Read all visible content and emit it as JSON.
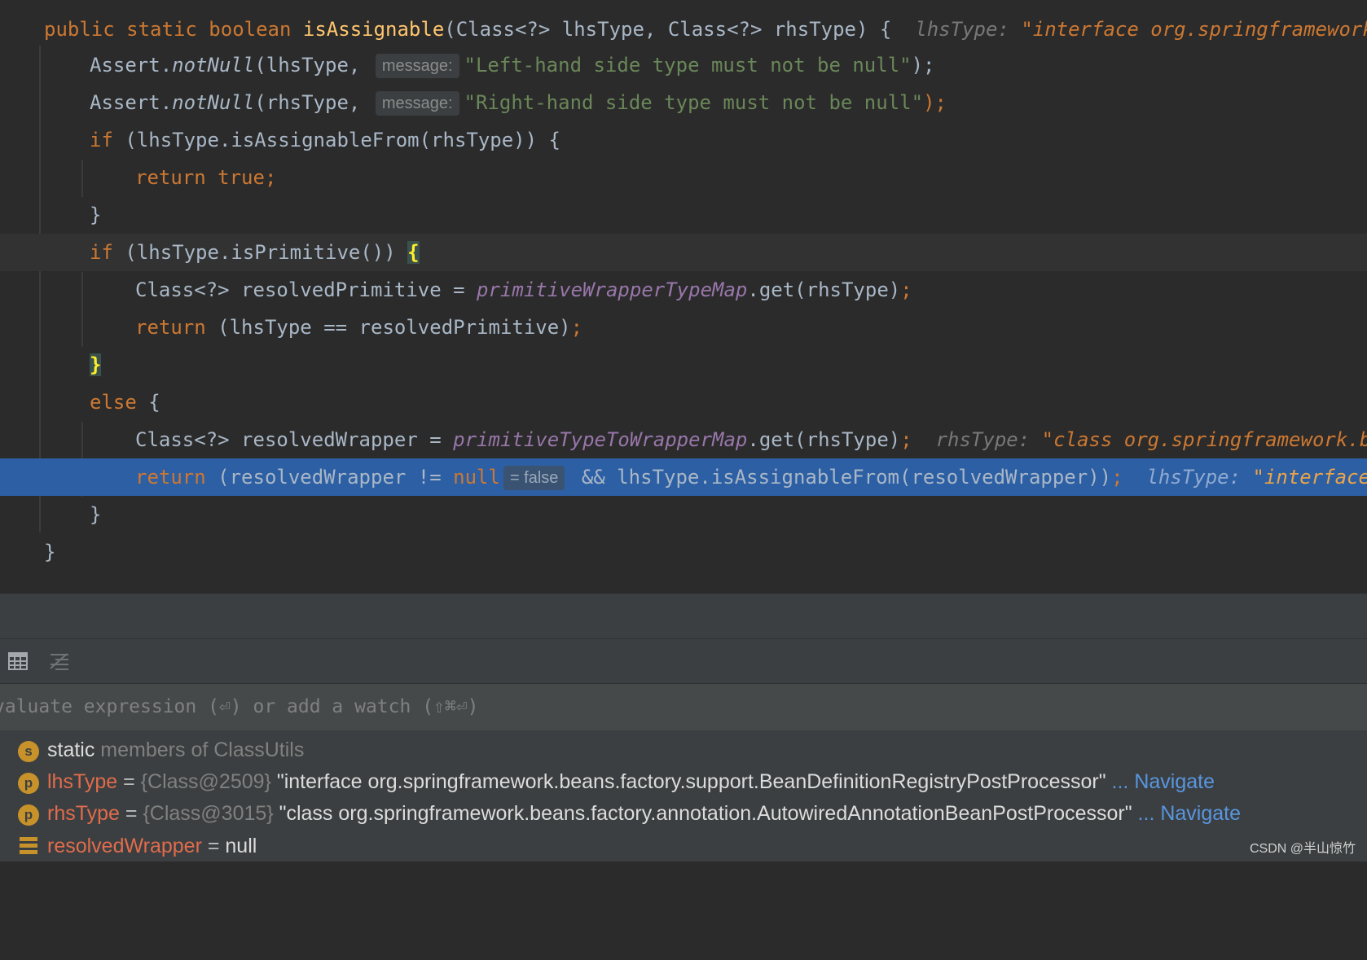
{
  "editor": {
    "l1": {
      "kw": "public static boolean ",
      "fn": "isAssignable",
      "rest": "(Class<?> lhsType, Class<?> rhsType) {",
      "hint_name": "lhsType:",
      "hint_val": "\"interface org.springframework.be"
    },
    "l2": {
      "a": "Assert.",
      "b": "notNull",
      "c": "(lhsType, ",
      "hint": "message:",
      "str": "\"Left-hand side type must not be null\"",
      "end": ");"
    },
    "l3": {
      "a": "Assert.",
      "b": "notNull",
      "c": "(rhsType, ",
      "hint": "message:",
      "str": "\"Right-hand side type must not be null\"",
      "end": ");"
    },
    "l4": {
      "kw": "if ",
      "rest": "(lhsType.isAssignableFrom(rhsType)) {"
    },
    "l5": {
      "kw": "return true;"
    },
    "l6": {
      "rest": "}"
    },
    "l7": {
      "kw": "if ",
      "rest": "(lhsType.isPrimitive()) ",
      "brace": "{"
    },
    "l8": {
      "a": "Class<?> resolvedPrimitive = ",
      "fld": "primitiveWrapperTypeMap",
      "b": ".get(rhsType)",
      "end": ";"
    },
    "l9": {
      "kw": "return ",
      "rest": "(lhsType == resolvedPrimitive)",
      "end": ";"
    },
    "l10": {
      "brace": "}"
    },
    "l11": {
      "kw": "else ",
      "rest": "{"
    },
    "l12": {
      "a": "Class<?> resolvedWrapper = ",
      "fld": "primitiveTypeToWrapperMap",
      "b": ".get(rhsType)",
      "end": ";",
      "hint_name": "rhsType:",
      "hint_val": "\"class org.springframework.bean"
    },
    "l13": {
      "kw": "return ",
      "a": "(resolvedWrapper != ",
      "null": "null",
      "hint": "= false",
      "b": " && lhsType.isAssignableFrom(resolvedWrapper))",
      "end": ";",
      "hint_name": "lhsType:",
      "hint_val": "\"interface o"
    },
    "l14": {
      "rest": "}"
    },
    "l15": {
      "rest": "}"
    }
  },
  "debugger": {
    "eval_placeholder": "valuate expression (⏎) or add a watch (⇧⌘⏎)",
    "vars": [
      {
        "badge": "s",
        "name": "static",
        "rest": " members of ClassUtils"
      },
      {
        "badge": "p",
        "name": "lhsType",
        "eq": " = ",
        "ref": "{Class@2509} ",
        "val": "\"interface org.springframework.beans.factory.support.BeanDefinitionRegistryPostProcessor\"",
        "link_pre": " ... ",
        "link": "Navigate"
      },
      {
        "badge": "p",
        "name": "rhsType",
        "eq": " = ",
        "ref": "{Class@3015} ",
        "val": "\"class org.springframework.beans.factory.annotation.AutowiredAnnotationBeanPostProcessor\"",
        "link_pre": " ... ",
        "link": "Navigate"
      },
      {
        "name": "resolvedWrapper",
        "eq": " = ",
        "val": "null"
      }
    ]
  },
  "watermark": "CSDN @半山惊竹",
  "colors": {
    "keyword": "#cc7832",
    "method": "#ffc66d",
    "string": "#6a8759",
    "field": "#9876aa",
    "exec_line": "#2d5fa4"
  }
}
